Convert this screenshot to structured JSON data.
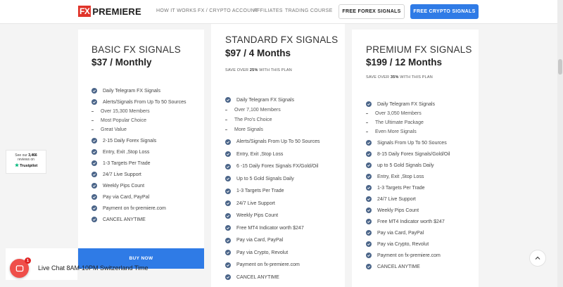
{
  "header": {
    "logo_fx": "FX",
    "logo_text": "PREMIERE",
    "nav": [
      "HOW IT WORKS",
      "FX / CRYPTO ACCOUNT",
      "AFFILIATES",
      "TRADING COURSE"
    ],
    "btn_forex": "FREE FOREX SIGNALS",
    "btn_crypto": "FREE CRYPTO SIGNALS"
  },
  "basic": {
    "name": "BASIC FX SIGNALS",
    "price": "$37 / Monthly",
    "features": [
      {
        "t": "c",
        "text": "Daily Telegram FX Signals"
      },
      {
        "t": "c",
        "text": "Alerts/Signals From Up To 50 Sources"
      },
      {
        "t": "d",
        "text": "Over 15,300 Members"
      },
      {
        "t": "d",
        "text": "Most Popular Choice"
      },
      {
        "t": "d",
        "text": "Great Value"
      },
      {
        "t": "c",
        "text": "2-15 Daily Forex Signals"
      },
      {
        "t": "c",
        "text": "Entry, Exit ,Stop Loss"
      },
      {
        "t": "c",
        "text": "1-3 Targets Per Trade"
      },
      {
        "t": "c",
        "text": "24/7 Live Support"
      },
      {
        "t": "c",
        "text": "Weekly Pips Count"
      },
      {
        "t": "c",
        "text": "Pay via Card, PayPal"
      },
      {
        "t": "c",
        "text": "Payment on fx-premiere.com"
      },
      {
        "t": "c",
        "text": "CANCEL ANYTIME"
      }
    ],
    "buy_label": "BUY NOW"
  },
  "standard": {
    "name": "STANDARD FX SIGNALS",
    "price": "$97 / 4 Months",
    "save_pre": "SAVE OVER ",
    "save_pct": "25%",
    "save_post": " WITH THIS PLAN",
    "features": [
      {
        "t": "c",
        "text": "Daily Telegram FX Signals"
      },
      {
        "t": "d",
        "text": "Over 7,100 Members"
      },
      {
        "t": "d",
        "text": "The Pro's Choice"
      },
      {
        "t": "d",
        "text": "More Signals"
      },
      {
        "t": "c",
        "text": "Alerts/Signals From Up To 50 Sources"
      },
      {
        "t": "c",
        "text": "Entry, Exit ,Stop Loss"
      },
      {
        "t": "c",
        "text": "6 -15 Daily Forex Signals FX/Gold/Oil"
      },
      {
        "t": "c",
        "text": "Up to 5 Gold Signals Daily"
      },
      {
        "t": "c",
        "text": "1-3 Targets Per Trade"
      },
      {
        "t": "c",
        "text": "24/7 Live Support"
      },
      {
        "t": "c",
        "text": "Weekly Pips Count"
      },
      {
        "t": "c",
        "text": "Free MT4 Indicator worth $247"
      },
      {
        "t": "c",
        "text": "Pay via Card, PayPal"
      },
      {
        "t": "c",
        "text": "Pay via Crypto, Revolut"
      },
      {
        "t": "c",
        "text": "Payment on fx-premiere.com"
      },
      {
        "t": "c",
        "text": "CANCEL ANYTIME"
      }
    ]
  },
  "premium": {
    "name": "PREMIUM FX SIGNALS",
    "price": "$199 / 12 Months",
    "save_pre": "SAVE OVER ",
    "save_pct": "35%",
    "save_post": " WITH THIS PLAN",
    "features": [
      {
        "t": "c",
        "text": "Daily Telegram FX Signals"
      },
      {
        "t": "d",
        "text": "Over 3,050 Members"
      },
      {
        "t": "d",
        "text": "The Ultimate Package"
      },
      {
        "t": "d",
        "text": "Even More Signals"
      },
      {
        "t": "c",
        "text": "Signals From Up To 50 Sources"
      },
      {
        "t": "c",
        "text": "8-15 Daily Forex Signals/Gold/Oil"
      },
      {
        "t": "c",
        "text": "up to 5 Gold Signals Daily"
      },
      {
        "t": "c",
        "text": "Entry, Exit ,Stop Loss"
      },
      {
        "t": "c",
        "text": "1-3 Targets Per Trade"
      },
      {
        "t": "c",
        "text": "24/7 Live Support"
      },
      {
        "t": "c",
        "text": "Weekly Pips Count"
      },
      {
        "t": "c",
        "text": "Free MT4 Indicator worth $247"
      },
      {
        "t": "c",
        "text": "Pay via Card, PayPal"
      },
      {
        "t": "c",
        "text": "Pay via Crypto, Revolut"
      },
      {
        "t": "c",
        "text": "Payment on fx-premiere.com"
      },
      {
        "t": "c",
        "text": "CANCEL ANYTIME"
      }
    ]
  },
  "trustpilot": {
    "line1_pre": "See our ",
    "count": "3,466",
    "line2": "reviews on",
    "brand": "Trustpilot"
  },
  "chat": {
    "badge": "1",
    "label": "Live Chat 8AM-10PM Switzerland Time"
  },
  "colors": {
    "accent": "#2f7be6",
    "check": "#4b6589",
    "logo_red": "#e0342a",
    "chat_red": "#ef4f4a"
  }
}
